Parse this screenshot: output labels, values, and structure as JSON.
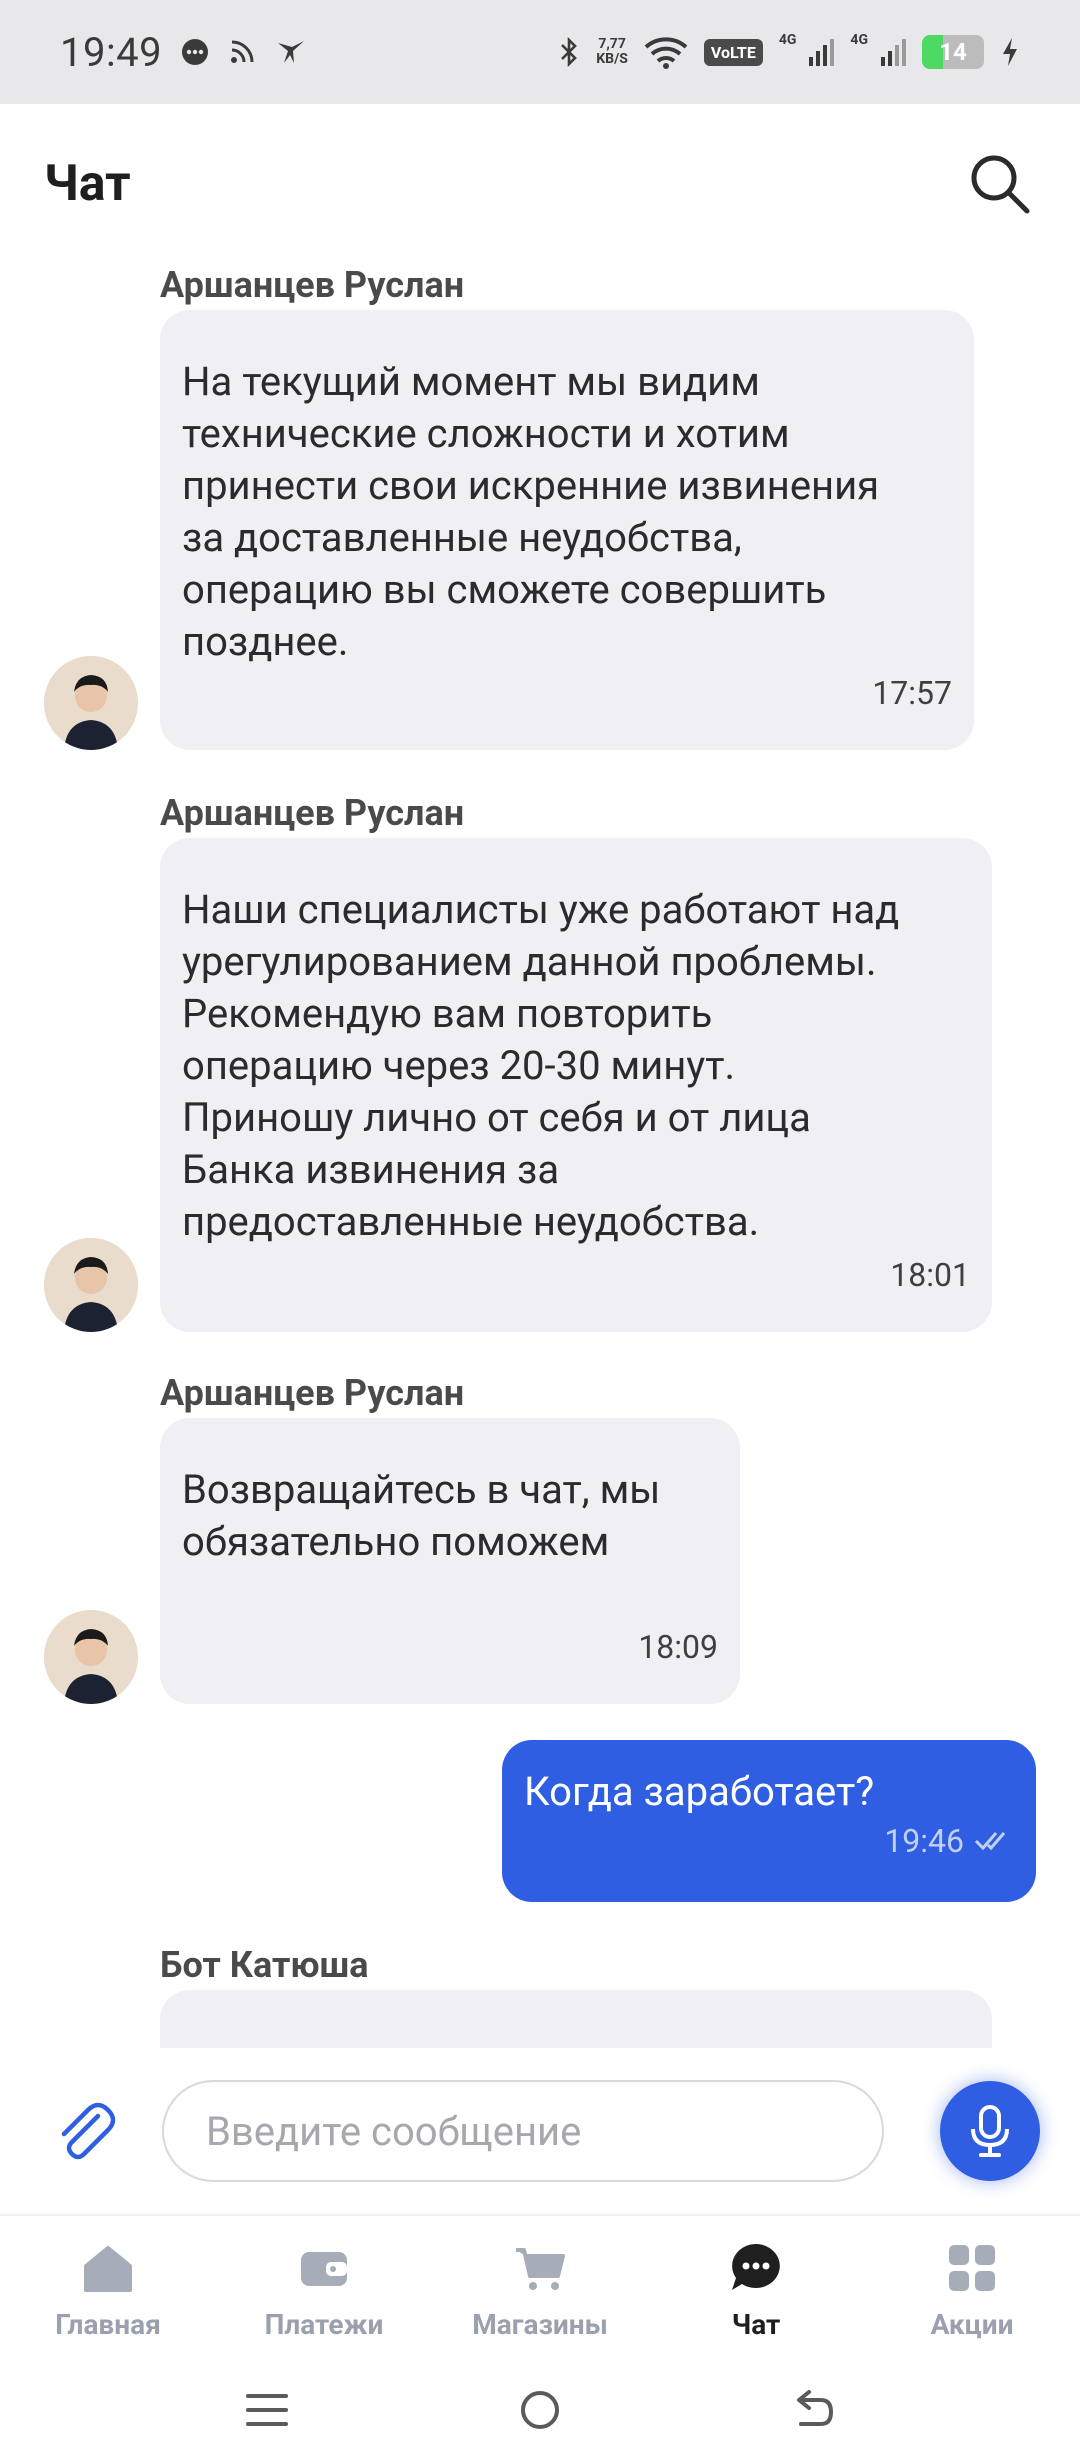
{
  "status_bar": {
    "time": "19:49",
    "net_speed_value": "7,77",
    "net_speed_unit": "KB/S",
    "volte": "VoLTE",
    "sim1_label": "4G",
    "sim2_label": "4G",
    "battery_percent": "14",
    "battery_level": 0.14,
    "icons": [
      "chat-bubble-icon",
      "rss-icon",
      "bird-icon",
      "bluetooth-icon",
      "wifi-icon",
      "signal-icon",
      "signal-icon",
      "charging-icon"
    ]
  },
  "header": {
    "title": "Чат",
    "search_icon": "search-icon"
  },
  "messages": [
    {
      "sender": "Аршанцев Руслан",
      "text": "На текущий момент мы видим\nтехнические сложности и хотим\nпринести свои искренние извинения\nза доставленные неудобства,\nоперацию вы сможете совершить\nпозднее.",
      "time": "17:57"
    },
    {
      "sender": "Аршанцев Руслан",
      "text": "Наши специалисты уже работают над\nурегулированием данной проблемы.\nРекомендую вам повторить\nоперацию через 20-30 минут.\nПриношу лично от себя и от лица\nБанка извинения за\nпредоставленные неудобства.",
      "time": "18:01"
    },
    {
      "sender": "Аршанцев Руслан",
      "text": "Возвращайтесь в чат, мы\nобязательно поможем",
      "time": "18:09"
    }
  ],
  "outgoing": {
    "text": "Когда заработает?",
    "time": "19:46",
    "status_icon": "double-check-icon"
  },
  "bot_message": {
    "sender": "Бот Катюша"
  },
  "input": {
    "placeholder": "Введите сообщение",
    "attach_icon": "paperclip-icon",
    "mic_icon": "microphone-icon"
  },
  "nav": {
    "items": [
      {
        "label": "Главная",
        "icon": "home-icon"
      },
      {
        "label": "Платежи",
        "icon": "wallet-icon"
      },
      {
        "label": "Магазины",
        "icon": "cart-icon"
      },
      {
        "label": "Чат",
        "icon": "chat-icon",
        "active": true
      },
      {
        "label": "Акции",
        "icon": "grid-icon"
      }
    ]
  },
  "colors": {
    "accent": "#2f5ee3",
    "incoming_bubble": "#efeff4",
    "inactive_nav": "#9aa0ad"
  }
}
